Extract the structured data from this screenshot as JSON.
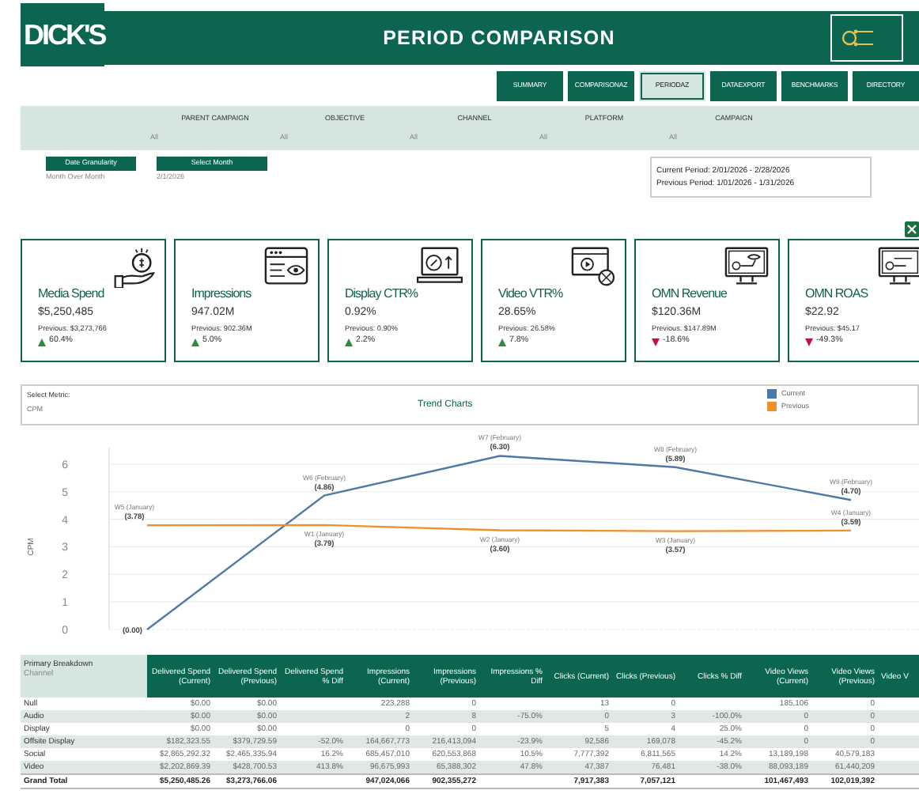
{
  "header": {
    "logo": "DICK'S",
    "title": "PERIOD COMPARISON"
  },
  "nav": [
    {
      "label": "SUMMARY",
      "selected": false
    },
    {
      "label": "COMPARISONAZ",
      "selected": false
    },
    {
      "label": "PERIODAZ",
      "selected": true
    },
    {
      "label": "DATAEXPORT",
      "selected": false
    },
    {
      "label": "BENCHMARKS",
      "selected": false
    },
    {
      "label": "DIRECTORY",
      "selected": false
    }
  ],
  "filters": [
    {
      "label": "PARENT CAMPAIGN",
      "value": "All"
    },
    {
      "label": "OBJECTIVE",
      "value": "All"
    },
    {
      "label": "CHANNEL",
      "value": "All"
    },
    {
      "label": "PLATFORM",
      "value": "All"
    },
    {
      "label": "CAMPAIGN",
      "value": "All"
    }
  ],
  "date_controls": [
    {
      "label": "Date Granularity",
      "value": "Month Over Month"
    },
    {
      "label": "Select Month",
      "value": "2/1/2026"
    }
  ],
  "period_info": [
    "Current Period: 2/01/2026 - 2/28/2026",
    "Previous Period: 1/01/2026 - 1/31/2026"
  ],
  "kpis": [
    {
      "kind": "spend",
      "title": "Media Spend",
      "value": "$5,250,485",
      "previous": "Previous: $3,273,766",
      "change": "60.4%",
      "increase": true
    },
    {
      "kind": "impressions",
      "title": "Impressions",
      "value": "947.02M",
      "previous": "Previous: 902.36M",
      "change": "5.0%",
      "increase": true
    },
    {
      "kind": "ctr",
      "title": "Display CTR%",
      "value": "0.92%",
      "previous": "Previous: 0.90%",
      "change": "2.2%",
      "increase": true
    },
    {
      "kind": "vtr",
      "title": "Video VTR%",
      "value": "28.65%",
      "previous": "Previous: 26.58%",
      "change": "7.8%",
      "increase": true
    },
    {
      "kind": "revenue",
      "title": "OMN Revenue",
      "value": "$120.36M",
      "previous": "Previous: $147.89M",
      "change": "-18.6%",
      "increase": false
    },
    {
      "kind": "roas",
      "title": "OMN ROAS",
      "value": "$22.92",
      "previous": "Previous: $45.17",
      "change": "-49.3%",
      "increase": false
    }
  ],
  "trend": {
    "metric_label": "Select Metric:",
    "metric": "CPM",
    "title": "Trend Charts",
    "chart_data": {
      "type": "line",
      "ylabel": "CPM",
      "categories": [
        null,
        null,
        null,
        null,
        null
      ],
      "yticks": [
        0,
        1,
        2,
        3,
        4,
        5,
        6
      ],
      "ylim": [
        0,
        6.6
      ],
      "grid": true,
      "series": [
        {
          "name": "Current",
          "color": "#4e79a7",
          "values": [
            0,
            4.86,
            6.3,
            5.89,
            4.7
          ],
          "value_labels": [
            "(0.00)",
            "(4.86)",
            "(6.30)",
            "(5.89)",
            "(4.70)"
          ]
        },
        {
          "name": "Previous",
          "color": "#f28e2b",
          "values": [
            3.78,
            3.79,
            3.6,
            3.57,
            3.59
          ],
          "value_labels": [
            "(3.78)",
            "(3.79)",
            "(3.60)",
            "(3.57)",
            "(3.59)"
          ]
        }
      ]
    },
    "week_labels": [
      [
        "W6 (February)",
        "W7 (February)",
        "W8 (February)",
        "W9 (February)"
      ],
      [
        "W5 (January)",
        "W1 (January)",
        "W2 (January)",
        "W3 (January)",
        "W4 (January)"
      ]
    ]
  },
  "table": {
    "header_title": "Primary Breakdown",
    "header_subtitle": "Channel",
    "columns": [
      "Delivered Spend (Current)",
      "Delivered Spend (Previous)",
      "Delivered Spend % Diff",
      "Impressions (Current)",
      "Impressions (Previous)",
      "Impressions % Diff",
      "Clicks (Current)",
      "Clicks (Previous)",
      "Clicks % Diff",
      "Video Views (Current)",
      "Video Views (Previous)",
      "Video V"
    ],
    "rows": [
      {
        "label": "Null",
        "total": false,
        "cells": [
          "$0.00",
          "$0.00",
          null,
          "223,288",
          "0",
          null,
          "13",
          "0",
          null,
          "185,106",
          "0"
        ]
      },
      {
        "label": "Audio",
        "total": false,
        "cells": [
          "$0.00",
          "$0.00",
          null,
          "2",
          "8",
          "-75.0%",
          "0",
          "3",
          "-100.0%",
          "0",
          "0"
        ]
      },
      {
        "label": "Display",
        "total": false,
        "cells": [
          "$0.00",
          "$0.00",
          null,
          "0",
          "0",
          null,
          "5",
          "4",
          "25.0%",
          "0",
          "0"
        ]
      },
      {
        "label": "Offsite Display",
        "total": false,
        "cells": [
          "$182,323.55",
          "$379,729.59",
          "-52.0%",
          "164,667,773",
          "216,413,094",
          "-23.9%",
          "92,586",
          "169,078",
          "-45.2%",
          "0",
          "0"
        ]
      },
      {
        "label": "Social",
        "total": false,
        "cells": [
          "$2,865,292.32",
          "$2,465,335.94",
          "16.2%",
          "685,457,010",
          "620,553,868",
          "10.5%",
          "7,777,392",
          "6,811,565",
          "14.2%",
          "13,189,198",
          "40,579,183"
        ]
      },
      {
        "label": "Video",
        "total": false,
        "cells": [
          "$2,202,869.39",
          "$428,700.53",
          "413.8%",
          "96,675,993",
          "65,388,302",
          "47.8%",
          "47,387",
          "76,481",
          "-38.0%",
          "88,093,189",
          "61,440,209"
        ]
      },
      {
        "label": "Grand Total",
        "total": true,
        "cells": [
          "$5,250,485.26",
          "$3,273,766.06",
          null,
          "947,024,066",
          "902,355,272",
          null,
          "7,917,383",
          "7,057,121",
          null,
          "101,467,493",
          "102,019,392"
        ]
      }
    ]
  }
}
